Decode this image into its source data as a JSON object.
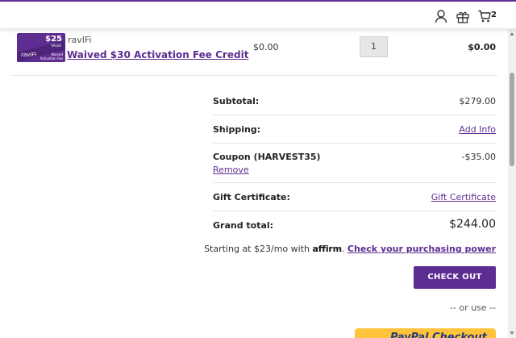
{
  "header": {
    "account_icon": "account-icon",
    "gift_icon": "gift-icon",
    "cart_icon": "cart-icon",
    "cart_count": "2"
  },
  "line_item": {
    "brand": "ravIFi",
    "title": "Waived $30 Activation Fee Credit",
    "unit_price": "$0.00",
    "quantity": "1",
    "total": "$0.00",
    "thumbnail": {
      "logo_text": "ravIFi",
      "value_text": "$25",
      "value_label": "VALUE",
      "caption": "Waived Activation Fee"
    }
  },
  "totals": {
    "subtotal_label": "Subtotal:",
    "subtotal_value": "$279.00",
    "shipping_label": "Shipping:",
    "shipping_link": "Add Info",
    "coupon_label": "Coupon (HARVEST35)",
    "coupon_value": "-$35.00",
    "coupon_remove": "Remove",
    "gift_label": "Gift Certificate:",
    "gift_link": "Gift Certificate",
    "grand_label": "Grand total:",
    "grand_value": "$244.00"
  },
  "affirm": {
    "prefix": "Starting at $23/mo with ",
    "logo": "affirm",
    "link": "Check your purchasing power"
  },
  "checkout": {
    "button_label": "CHECK OUT",
    "or_use": "-- or use --",
    "paypal_label": "PayPal Checkout"
  },
  "colors": {
    "accent": "#5e2d91",
    "paypal": "#ffc439"
  }
}
